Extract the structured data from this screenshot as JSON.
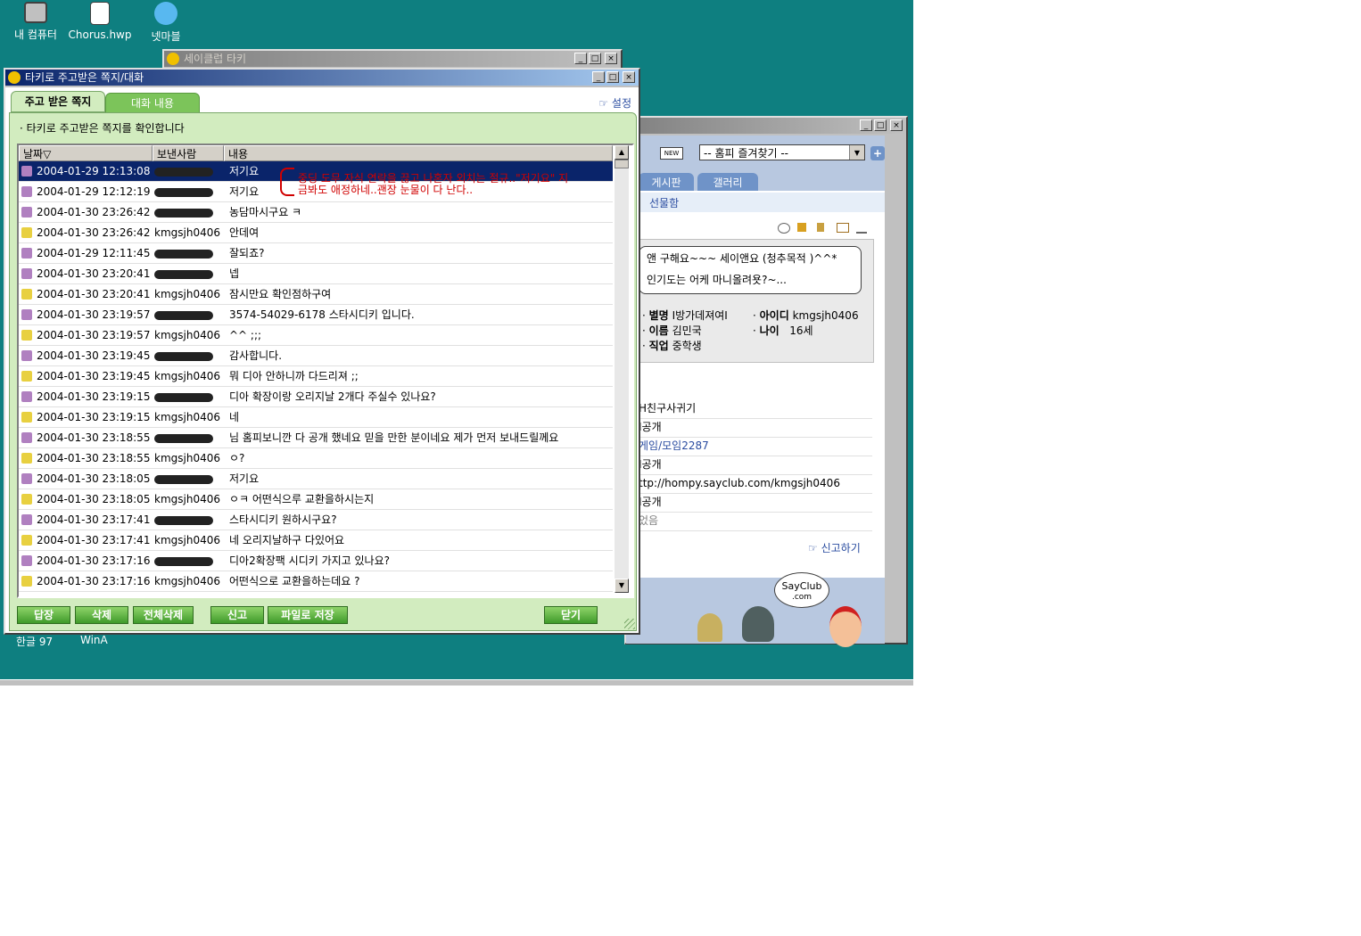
{
  "desktop": {
    "icons": [
      {
        "label": "내 컴퓨터",
        "icon": "my-computer-icon"
      },
      {
        "label": "Chorus.hwp",
        "icon": "document-icon"
      },
      {
        "label": "넷마블",
        "icon": "netmarble-icon"
      }
    ],
    "taskbar_labels": [
      "한글 97",
      "WinA"
    ]
  },
  "tacky_window": {
    "title": "세이클럽 타키"
  },
  "homepage_window": {
    "favorites_select": "-- 홈피 즐겨찾기 --",
    "new_badge": "NEW",
    "tabs": [
      "게시판",
      "갤러리"
    ],
    "section_label": "선물함",
    "speech": [
      "앤 구해요~~~ 세이앤요 (청추목적 )^^*",
      "인기도는 어케 마니올려욧?~..."
    ],
    "profile": {
      "nick_label": "별명",
      "nick_value": "I방가데져여I",
      "id_label": "아이디",
      "id_value": "kmgsjh0406",
      "name_label": "이름",
      "name_value": "김민국",
      "age_label": "나이",
      "age_value": "16세",
      "job_label": "직업",
      "job_value": "중학생"
    },
    "info_rows": [
      "H친구사귀기",
      "I공개",
      "게임/모임2287",
      "I공개",
      "ttp://hompy.sayclub.com/kmgsjh0406",
      "I공개",
      "었음"
    ],
    "report_label": "신고하기",
    "logo_text": "SayClub",
    "logo_sub": ".com"
  },
  "message_window": {
    "title": "타키로 주고받은 쪽지/대화",
    "tabs": [
      "주고 받은 쪽지",
      "대화 내용"
    ],
    "settings_label": "설정",
    "subtitle": "· 타키로 주고받은 쪽지를 확인합니다",
    "columns": [
      "날짜▽",
      "보낸사람",
      "내용"
    ],
    "rows": [
      {
        "date": "2004-01-29 12:13:08",
        "sender": "",
        "content": "저기요"
      },
      {
        "date": "2004-01-29 12:12:19",
        "sender": "",
        "content": "저기요"
      },
      {
        "date": "2004-01-30 23:26:42",
        "sender": "",
        "content": "농담마시구요 ㅋ"
      },
      {
        "date": "2004-01-30 23:26:42",
        "sender": "kmgsjh0406",
        "content": "안데여"
      },
      {
        "date": "2004-01-29 12:11:45",
        "sender": "",
        "content": "잘되죠?"
      },
      {
        "date": "2004-01-30 23:20:41",
        "sender": "",
        "content": "넵"
      },
      {
        "date": "2004-01-30 23:20:41",
        "sender": "kmgsjh0406",
        "content": "잠시만요 확인점하구여"
      },
      {
        "date": "2004-01-30 23:19:57",
        "sender": "",
        "content": "3574-54029-6178 스타시디키 입니다."
      },
      {
        "date": "2004-01-30 23:19:57",
        "sender": "kmgsjh0406",
        "content": "^^ ;;;"
      },
      {
        "date": "2004-01-30 23:19:45",
        "sender": "",
        "content": "감사합니다."
      },
      {
        "date": "2004-01-30 23:19:45",
        "sender": "kmgsjh0406",
        "content": "뭐 디아 안하니까 다드리져 ;;"
      },
      {
        "date": "2004-01-30 23:19:15",
        "sender": "",
        "content": "디아 확장이랑 오리지날 2개다 주실수 있나요?"
      },
      {
        "date": "2004-01-30 23:19:15",
        "sender": "kmgsjh0406",
        "content": "네"
      },
      {
        "date": "2004-01-30 23:18:55",
        "sender": "",
        "content": "님 홈피보니깐 다 공개 했네요 믿을 만한 분이네요 제가 먼저 보내드릴께요"
      },
      {
        "date": "2004-01-30 23:18:55",
        "sender": "kmgsjh0406",
        "content": "ㅇ?"
      },
      {
        "date": "2004-01-30 23:18:05",
        "sender": "",
        "content": "저기요"
      },
      {
        "date": "2004-01-30 23:18:05",
        "sender": "kmgsjh0406",
        "content": "ㅇㅋ 어떤식으루 교환을하시는지"
      },
      {
        "date": "2004-01-30 23:17:41",
        "sender": "",
        "content": "스타시디키 원하시구요?"
      },
      {
        "date": "2004-01-30 23:17:41",
        "sender": "kmgsjh0406",
        "content": "네 오리지날하구 다있어요"
      },
      {
        "date": "2004-01-30 23:17:16",
        "sender": "",
        "content": "디아2확장팩 시디키 가지고 있나요?"
      },
      {
        "date": "2004-01-30 23:17:16",
        "sender": "kmgsjh0406",
        "content": "어떤식으로 교환을하는데요 ?"
      }
    ],
    "annotation": [
      "중딩 도무 자식 연락을 끊고 나혼자 외치는 절규..\"저기요\" 지",
      "금봐도 애정하네..괜장 눈물이 다 난다.."
    ],
    "buttons": {
      "reply": "답장",
      "delete": "삭제",
      "delete_all": "전체삭제",
      "report": "신고",
      "save_file": "파일로 저장",
      "close": "닫기"
    }
  }
}
